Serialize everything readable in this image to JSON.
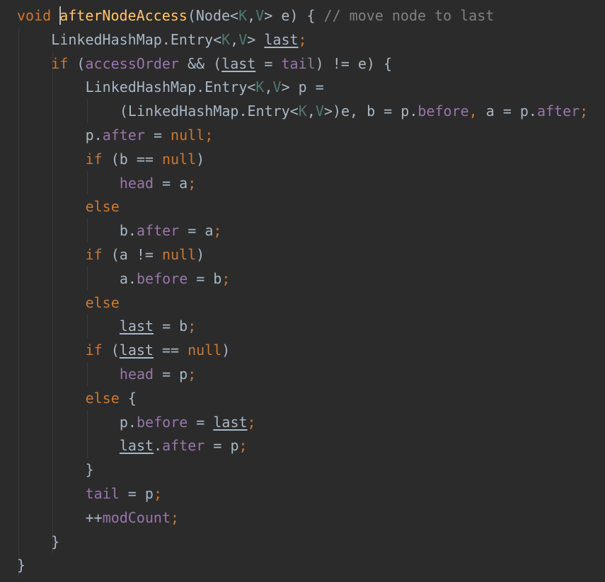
{
  "editor": {
    "language": "java",
    "colors": {
      "background": "#2b2b2b",
      "keyword": "#cc7832",
      "method": "#ffc66d",
      "plain": "#a9b7c6",
      "type_param": "#507874",
      "field": "#9876aa",
      "comment": "#808080"
    },
    "lines": [
      {
        "indent": 0,
        "tokens": [
          {
            "t": "void",
            "k": "keyword"
          },
          {
            "t": " ",
            "k": "plain"
          },
          {
            "t": "afterNodeAccess",
            "k": "method"
          },
          {
            "t": "(Node<",
            "k": "plain"
          },
          {
            "t": "K",
            "k": "typeparam"
          },
          {
            "t": ",",
            "k": "plain"
          },
          {
            "t": "V",
            "k": "typeparam"
          },
          {
            "t": "> e) { ",
            "k": "plain"
          },
          {
            "t": "// move node to last",
            "k": "comment"
          }
        ]
      },
      {
        "indent": 1,
        "tokens": [
          {
            "t": "LinkedHashMap.Entry<",
            "k": "plain"
          },
          {
            "t": "K",
            "k": "typeparam"
          },
          {
            "t": ",",
            "k": "plain"
          },
          {
            "t": "V",
            "k": "typeparam"
          },
          {
            "t": "> ",
            "k": "plain"
          },
          {
            "t": "last",
            "k": "plain",
            "u": true
          },
          {
            "t": ";",
            "k": "punct"
          }
        ]
      },
      {
        "indent": 1,
        "tokens": [
          {
            "t": "if",
            "k": "keyword"
          },
          {
            "t": " (",
            "k": "plain"
          },
          {
            "t": "accessOrder",
            "k": "field"
          },
          {
            "t": " && (",
            "k": "plain"
          },
          {
            "t": "last",
            "k": "plain",
            "u": true
          },
          {
            "t": " = ",
            "k": "plain"
          },
          {
            "t": "tail",
            "k": "field"
          },
          {
            "t": ") != e) {",
            "k": "plain"
          }
        ]
      },
      {
        "indent": 2,
        "tokens": [
          {
            "t": "LinkedHashMap.Entry<",
            "k": "plain"
          },
          {
            "t": "K",
            "k": "typeparam"
          },
          {
            "t": ",",
            "k": "plain"
          },
          {
            "t": "V",
            "k": "typeparam"
          },
          {
            "t": "> p =",
            "k": "plain"
          }
        ]
      },
      {
        "indent": 3,
        "tokens": [
          {
            "t": "(LinkedHashMap.Entry<",
            "k": "plain"
          },
          {
            "t": "K",
            "k": "typeparam"
          },
          {
            "t": ",",
            "k": "plain"
          },
          {
            "t": "V",
            "k": "typeparam"
          },
          {
            "t": ">)e, b = p.",
            "k": "plain"
          },
          {
            "t": "before",
            "k": "field"
          },
          {
            "t": ", ",
            "k": "punct"
          },
          {
            "t": "a = p.",
            "k": "plain"
          },
          {
            "t": "after",
            "k": "field"
          },
          {
            "t": ";",
            "k": "punct"
          }
        ]
      },
      {
        "indent": 2,
        "tokens": [
          {
            "t": "p.",
            "k": "plain"
          },
          {
            "t": "after",
            "k": "field"
          },
          {
            "t": " = ",
            "k": "plain"
          },
          {
            "t": "null",
            "k": "keyword"
          },
          {
            "t": ";",
            "k": "punct"
          }
        ]
      },
      {
        "indent": 2,
        "tokens": [
          {
            "t": "if",
            "k": "keyword"
          },
          {
            "t": " (b == ",
            "k": "plain"
          },
          {
            "t": "null",
            "k": "keyword"
          },
          {
            "t": ")",
            "k": "plain"
          }
        ]
      },
      {
        "indent": 3,
        "tokens": [
          {
            "t": "head",
            "k": "field"
          },
          {
            "t": " = a",
            "k": "plain"
          },
          {
            "t": ";",
            "k": "punct"
          }
        ]
      },
      {
        "indent": 2,
        "tokens": [
          {
            "t": "else",
            "k": "keyword"
          }
        ]
      },
      {
        "indent": 3,
        "tokens": [
          {
            "t": "b.",
            "k": "plain"
          },
          {
            "t": "after",
            "k": "field"
          },
          {
            "t": " = a",
            "k": "plain"
          },
          {
            "t": ";",
            "k": "punct"
          }
        ]
      },
      {
        "indent": 2,
        "tokens": [
          {
            "t": "if",
            "k": "keyword"
          },
          {
            "t": " (a != ",
            "k": "plain"
          },
          {
            "t": "null",
            "k": "keyword"
          },
          {
            "t": ")",
            "k": "plain"
          }
        ]
      },
      {
        "indent": 3,
        "tokens": [
          {
            "t": "a.",
            "k": "plain"
          },
          {
            "t": "before",
            "k": "field"
          },
          {
            "t": " = b",
            "k": "plain"
          },
          {
            "t": ";",
            "k": "punct"
          }
        ]
      },
      {
        "indent": 2,
        "tokens": [
          {
            "t": "else",
            "k": "keyword"
          }
        ]
      },
      {
        "indent": 3,
        "tokens": [
          {
            "t": "last",
            "k": "plain",
            "u": true
          },
          {
            "t": " = b",
            "k": "plain"
          },
          {
            "t": ";",
            "k": "punct"
          }
        ]
      },
      {
        "indent": 2,
        "tokens": [
          {
            "t": "if",
            "k": "keyword"
          },
          {
            "t": " (",
            "k": "plain"
          },
          {
            "t": "last",
            "k": "plain",
            "u": true
          },
          {
            "t": " == ",
            "k": "plain"
          },
          {
            "t": "null",
            "k": "keyword"
          },
          {
            "t": ")",
            "k": "plain"
          }
        ]
      },
      {
        "indent": 3,
        "tokens": [
          {
            "t": "head",
            "k": "field"
          },
          {
            "t": " = p",
            "k": "plain"
          },
          {
            "t": ";",
            "k": "punct"
          }
        ]
      },
      {
        "indent": 2,
        "tokens": [
          {
            "t": "else",
            "k": "keyword"
          },
          {
            "t": " {",
            "k": "plain"
          }
        ]
      },
      {
        "indent": 3,
        "tokens": [
          {
            "t": "p.",
            "k": "plain"
          },
          {
            "t": "before",
            "k": "field"
          },
          {
            "t": " = ",
            "k": "plain"
          },
          {
            "t": "last",
            "k": "plain",
            "u": true
          },
          {
            "t": ";",
            "k": "punct"
          }
        ]
      },
      {
        "indent": 3,
        "tokens": [
          {
            "t": "last",
            "k": "plain",
            "u": true
          },
          {
            "t": ".",
            "k": "plain"
          },
          {
            "t": "after",
            "k": "field"
          },
          {
            "t": " = p",
            "k": "plain"
          },
          {
            "t": ";",
            "k": "punct"
          }
        ]
      },
      {
        "indent": 2,
        "tokens": [
          {
            "t": "}",
            "k": "plain"
          }
        ]
      },
      {
        "indent": 2,
        "tokens": [
          {
            "t": "tail",
            "k": "field"
          },
          {
            "t": " = p",
            "k": "plain"
          },
          {
            "t": ";",
            "k": "punct"
          }
        ]
      },
      {
        "indent": 2,
        "tokens": [
          {
            "t": "++",
            "k": "plain"
          },
          {
            "t": "modCount",
            "k": "field"
          },
          {
            "t": ";",
            "k": "punct"
          }
        ]
      },
      {
        "indent": 1,
        "tokens": [
          {
            "t": "}",
            "k": "plain"
          }
        ]
      },
      {
        "indent": 0,
        "tokens": [
          {
            "t": "}",
            "k": "plain"
          }
        ]
      }
    ]
  }
}
